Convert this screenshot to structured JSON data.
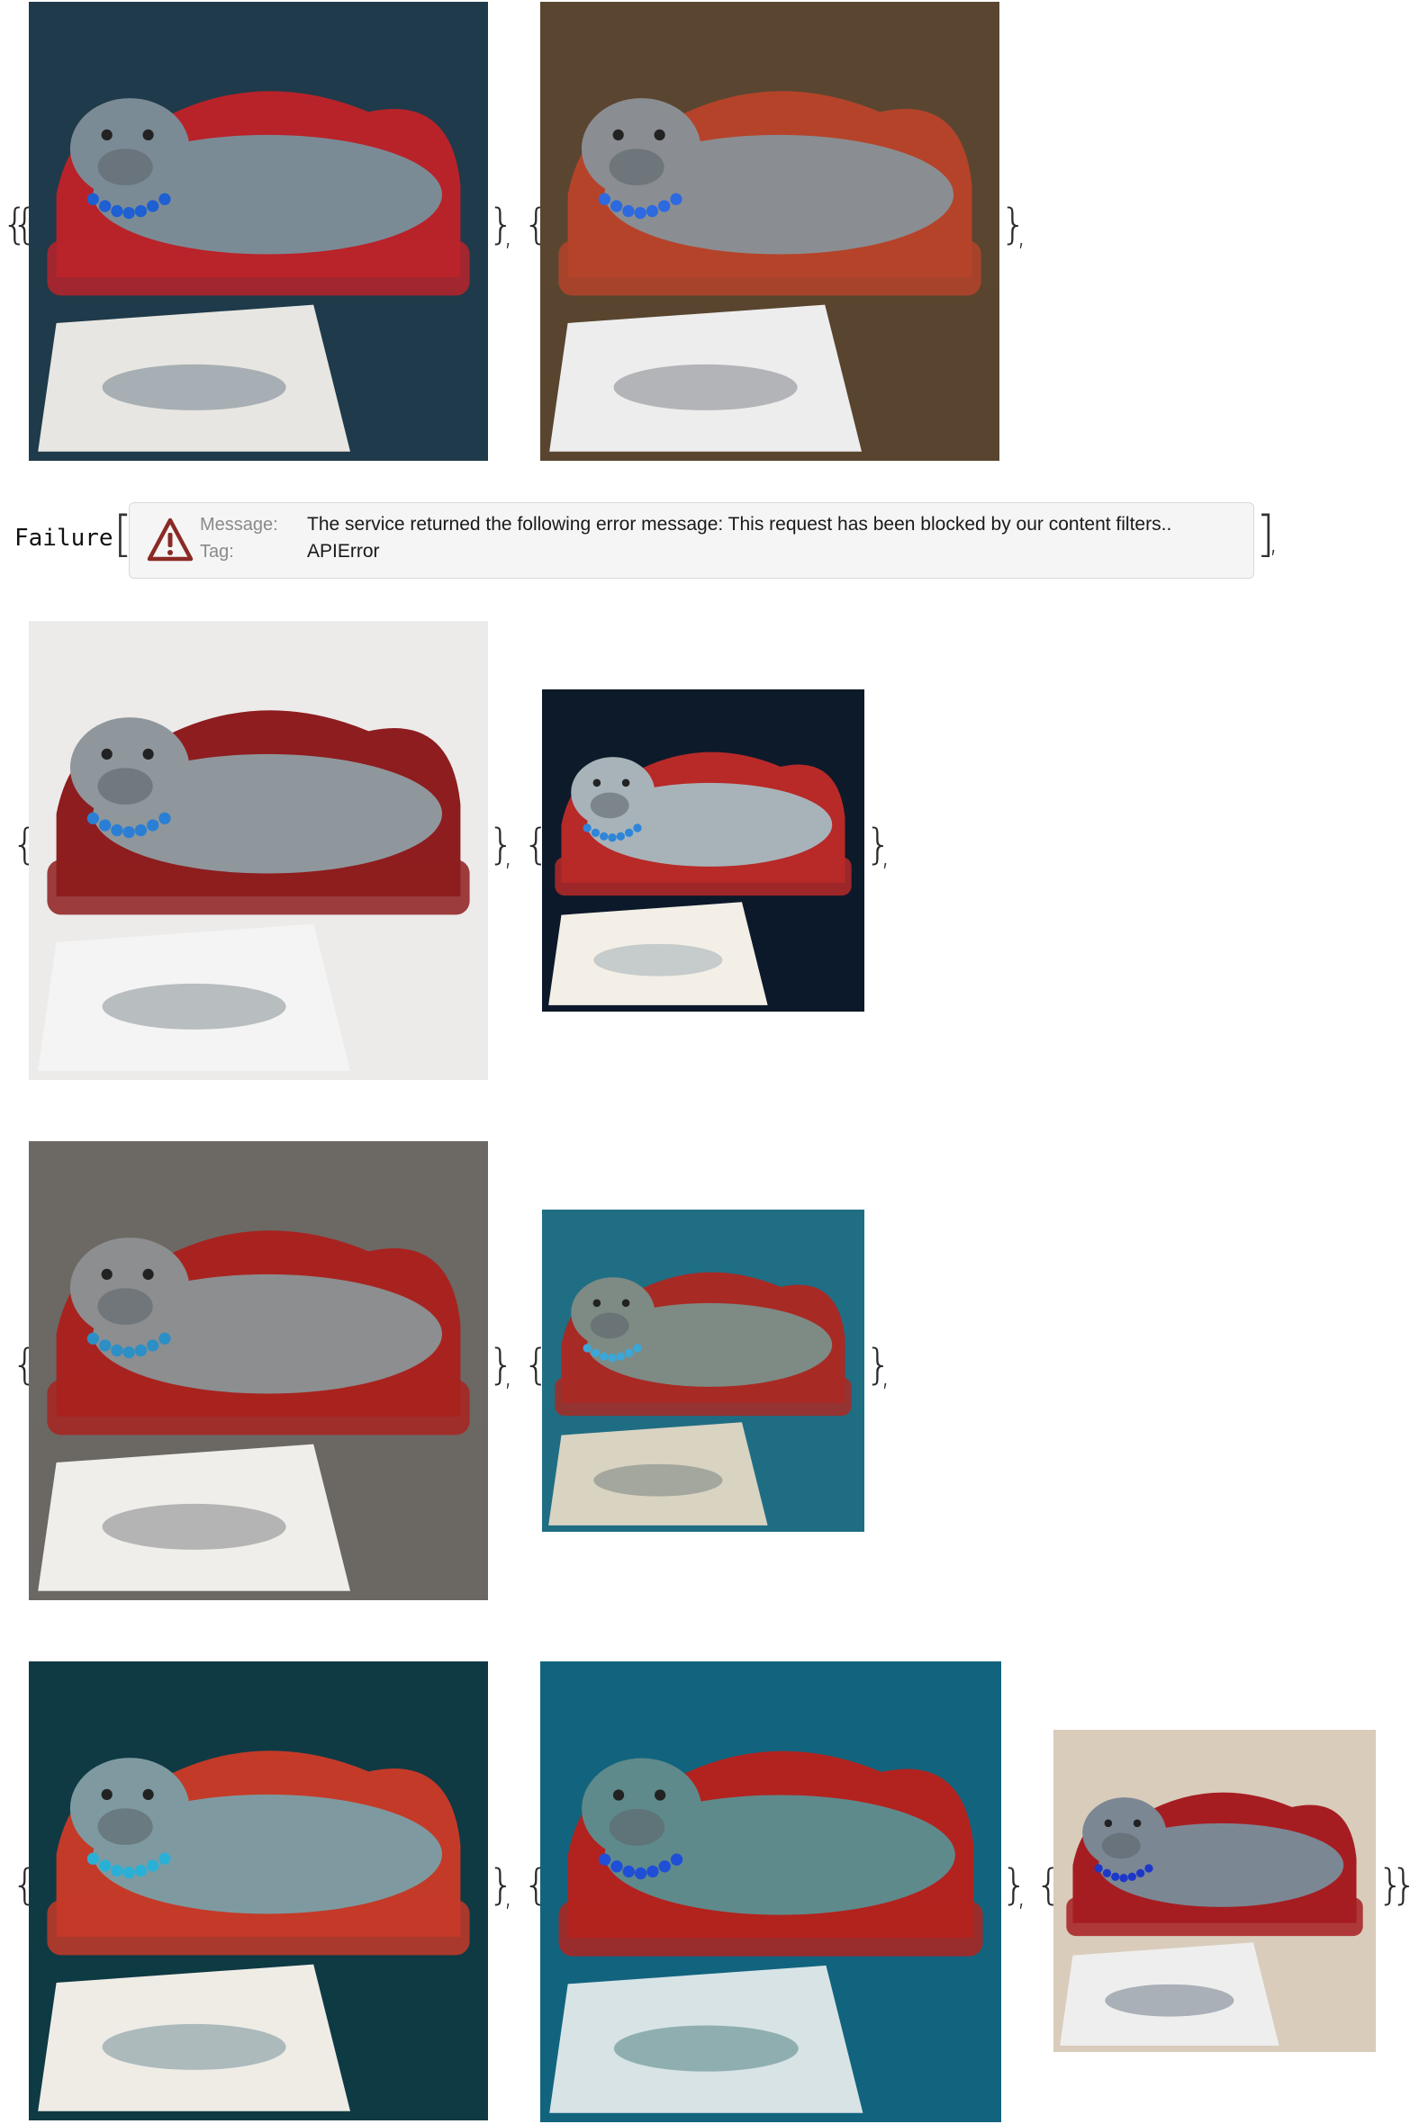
{
  "row1": {
    "images": [
      {
        "name": "manatee-jewels-sofa-pencil-drawing",
        "palette": {
          "bg": "#1f3a4a",
          "sofa": "#b8232a",
          "body": "#7b8b96",
          "paper": "#e8e6e2",
          "jewel": "#1e5fd1"
        }
      },
      {
        "name": "manatee-red-dress-painting-closeup",
        "palette": {
          "bg": "#5a4630",
          "sofa": "#b5432a",
          "body": "#8a8e92",
          "paper": "#ededed",
          "jewel": "#2d6ae0"
        }
      }
    ]
  },
  "failure": {
    "head": "Failure",
    "message_label": "Message:",
    "message_value": "The service returned the following error message: This request has been blocked by our content filters..",
    "tag_label": "Tag:",
    "tag_value": "APIError",
    "icon": "warning-triangle-icon",
    "icon_color": "#8b2a25"
  },
  "row3": {
    "images": [
      {
        "name": "manatee-sofa-walrus-artist-easel",
        "palette": {
          "bg": "#ecebea",
          "sofa": "#8e1d1f",
          "body": "#8f979c",
          "paper": "#f4f4f4",
          "jewel": "#2a7fd4"
        }
      },
      {
        "name": "manatee-sofa-blue-painting-hand",
        "palette": {
          "bg": "#0d1a2a",
          "sofa": "#b72a28",
          "body": "#a8b3b9",
          "paper": "#f3efe6",
          "jewel": "#2f86d9"
        }
      }
    ]
  },
  "row4": {
    "images": [
      {
        "name": "manatee-jewels-sofa-gilded-frame",
        "palette": {
          "bg": "#6c6864",
          "sofa": "#a8231f",
          "body": "#8c8e90",
          "paper": "#f0eeea",
          "jewel": "#2c8fc6"
        }
      },
      {
        "name": "manatee-underwater-sofa",
        "palette": {
          "bg": "#1f6e84",
          "sofa": "#a82a24",
          "body": "#7e8a84",
          "paper": "#d9d3c2",
          "jewel": "#3ba7d8"
        }
      }
    ]
  },
  "row5": {
    "images": [
      {
        "name": "manatee-ornate-sofa-underwater-drawing",
        "palette": {
          "bg": "#0f3a44",
          "sofa": "#c43a28",
          "body": "#7e9aa0",
          "paper": "#efece6",
          "jewel": "#2ab0d6"
        }
      },
      {
        "name": "manatee-sofa-ocean-walrus-artist",
        "palette": {
          "bg": "#12647e",
          "sofa": "#b2231f",
          "body": "#5f8a8c",
          "paper": "#d8e3e6",
          "jewel": "#1f4fd6"
        }
      },
      {
        "name": "manatee-sofa-sepia-painter",
        "palette": {
          "bg": "#d9ccbb",
          "sofa": "#a61d21",
          "body": "#7c8794",
          "paper": "#eeeeee",
          "jewel": "#1d38c9"
        }
      }
    ]
  },
  "symbols": {
    "open_brace": "{",
    "close_brace": "}",
    "comma": ",",
    "open_bracket": "[",
    "close_bracket": "]"
  }
}
